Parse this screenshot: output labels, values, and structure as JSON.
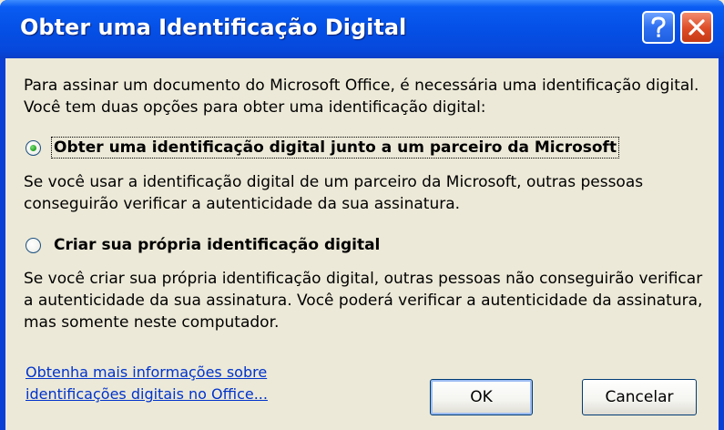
{
  "window": {
    "title": "Obter uma Identificação Digital",
    "help_symbol": "?",
    "close_symbol": "X"
  },
  "dialog": {
    "intro": "Para assinar um documento do Microsoft Office, é necessária uma identificação digital. Você tem duas opções para obter uma identificação digital:",
    "options": [
      {
        "label": "Obter uma identificação digital junto a um parceiro da Microsoft",
        "description": "Se você usar a identificação digital de um parceiro da Microsoft, outras pessoas conseguirão verificar a autenticidade da sua assinatura.",
        "selected": true
      },
      {
        "label": "Criar sua própria identificação digital",
        "description": "Se você criar sua própria identificação digital, outras pessoas não conseguirão verificar a autenticidade da sua assinatura. Você poderá verificar a autenticidade da assinatura, mas somente neste computador.",
        "selected": false
      }
    ],
    "more_info_link": "Obtenha mais informações sobre identificações digitais no Office...",
    "ok_label": "OK",
    "cancel_label": "Cancelar"
  },
  "colors": {
    "titlebar": "#0550e6",
    "dialog_bg": "#ece9d8",
    "link": "#0033cc",
    "close_button": "#dd4b26"
  },
  "icons": [
    "help-icon",
    "close-icon",
    "radio-selected-icon",
    "radio-unselected-icon"
  ]
}
